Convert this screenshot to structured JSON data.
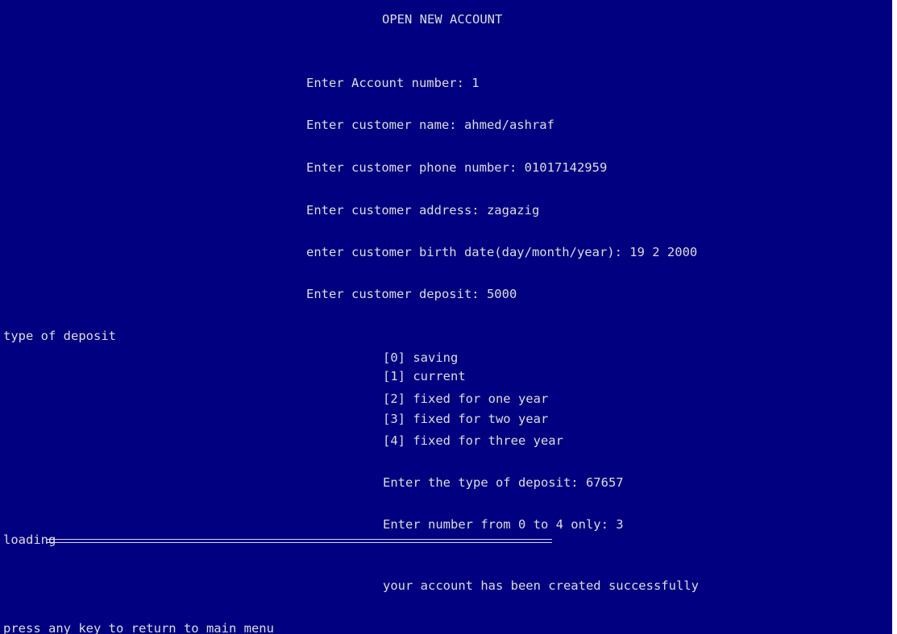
{
  "console": {
    "header": "OPEN NEW ACCOUNT",
    "prompts": {
      "account_number": "Enter Account number: 1",
      "customer_name": "Enter customer name: ahmed/ashraf",
      "phone_number": "Enter customer phone number: 01017142959",
      "address": "Enter customer address: zagazig",
      "birth_date": "enter customer birth date(day/month/year): 19 2 2000",
      "deposit": "Enter customer deposit: 5000"
    },
    "deposit_type_label": "type of deposit",
    "deposit_options": [
      "[0] saving",
      "[1] current",
      "[2] fixed for one year",
      "[3] fixed for two year",
      "[4] fixed for three year"
    ],
    "type_prompt": "Enter the type of deposit: 67657",
    "range_prompt": "Enter number from 0 to 4 only: 3",
    "loading_label": "loading",
    "success_message": "your account has been created successfully",
    "return_prompt": "press any key to return to main menu",
    "colors": {
      "background": "#000080",
      "text": "#dcdcdc"
    }
  }
}
